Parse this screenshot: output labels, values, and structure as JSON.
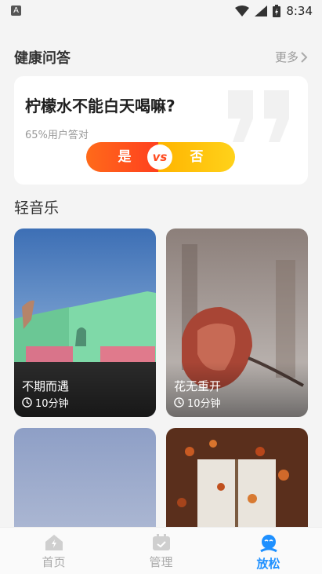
{
  "status": {
    "app_badge": "A",
    "time": "8:34"
  },
  "qa": {
    "section_title": "健康问答",
    "more": "更多",
    "question": "柠檬水不能白天喝嘛?",
    "stat": "65%用户答对",
    "yes": "是",
    "vs": "vs",
    "no": "否"
  },
  "music": {
    "section_title": "轻音乐",
    "items": [
      {
        "name": "不期而遇",
        "duration": "10分钟"
      },
      {
        "name": "花无重开",
        "duration": "10分钟"
      }
    ]
  },
  "tabs": [
    {
      "label": "首页",
      "icon": "home-icon"
    },
    {
      "label": "管理",
      "icon": "calendar-check-icon"
    },
    {
      "label": "放松",
      "icon": "relax-face-icon",
      "active": true
    }
  ],
  "colors": {
    "accent": "#1e90ff",
    "yes": "#ff4a1f",
    "no": "#ffc107"
  }
}
